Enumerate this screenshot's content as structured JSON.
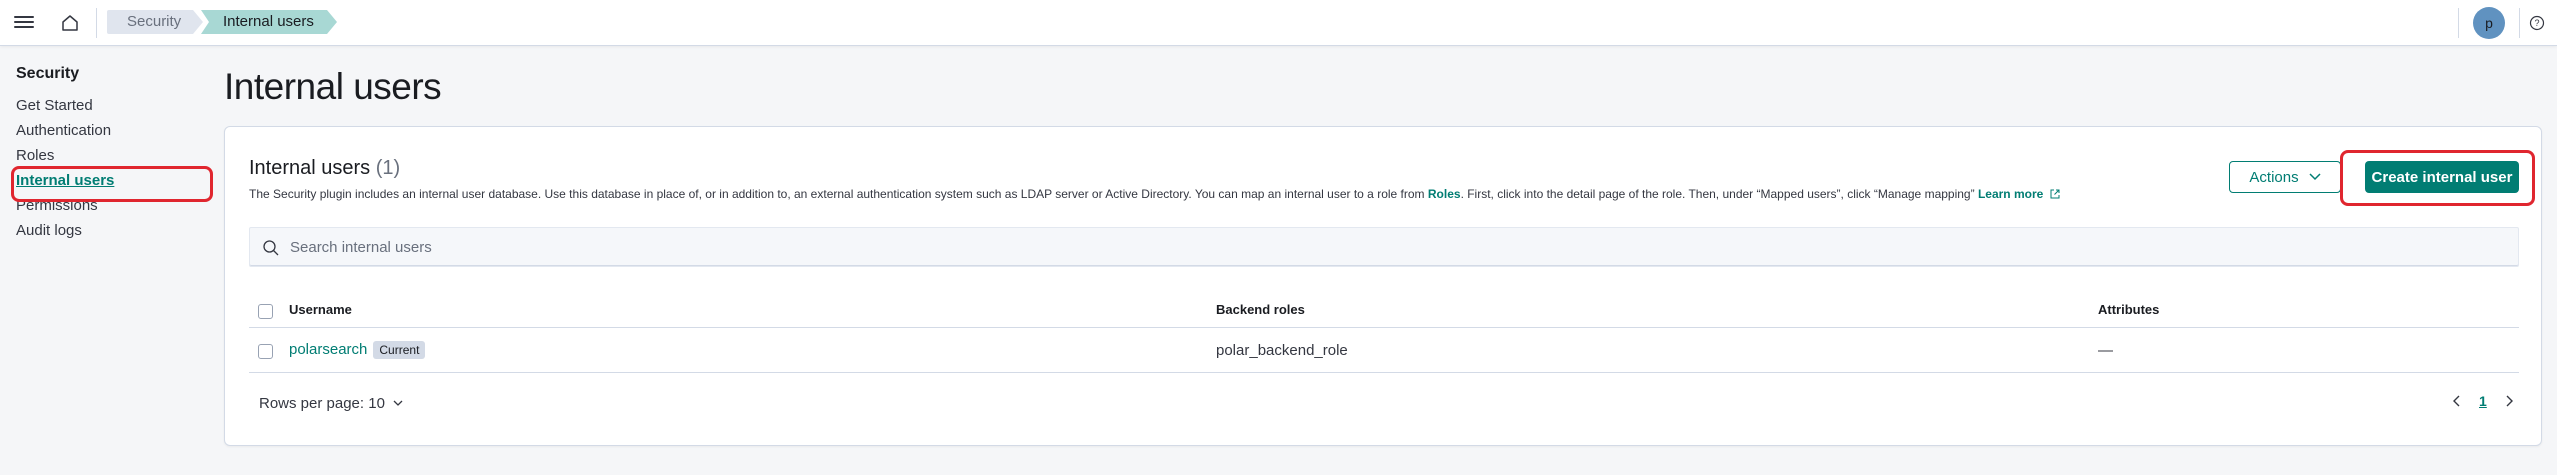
{
  "header": {
    "breadcrumbs": [
      "Security",
      "Internal users"
    ],
    "avatar_initial": "p"
  },
  "sidebar": {
    "title": "Security",
    "items": [
      {
        "label": "Get Started",
        "active": false
      },
      {
        "label": "Authentication",
        "active": false
      },
      {
        "label": "Roles",
        "active": false
      },
      {
        "label": "Internal users",
        "active": true
      },
      {
        "label": "Permissions",
        "active": false
      },
      {
        "label": "Audit logs",
        "active": false
      }
    ]
  },
  "main": {
    "page_title": "Internal users",
    "panel": {
      "title": "Internal users",
      "count": "(1)",
      "description_part1": "The Security plugin includes an internal user database. Use this database in place of, or in addition to, an external authentication system such as LDAP server or Active Directory. You can map an internal user to a role from ",
      "description_roles_link": "Roles",
      "description_part2": ". First, click into the detail page of the role. Then, under “Mapped users”, click “Manage mapping” ",
      "learn_more": "Learn more",
      "actions_label": "Actions",
      "create_label": "Create internal user",
      "search_placeholder": "Search internal users"
    },
    "table": {
      "columns": [
        "Username",
        "Backend roles",
        "Attributes"
      ],
      "rows": [
        {
          "username": "polarsearch",
          "badge": "Current",
          "backend_roles": "polar_backend_role",
          "attributes": "—"
        }
      ]
    },
    "pagination": {
      "rows_per_page": "Rows per page: 10",
      "current_page": "1"
    }
  },
  "colors": {
    "accent": "#017d73",
    "highlight": "#e0262f"
  }
}
